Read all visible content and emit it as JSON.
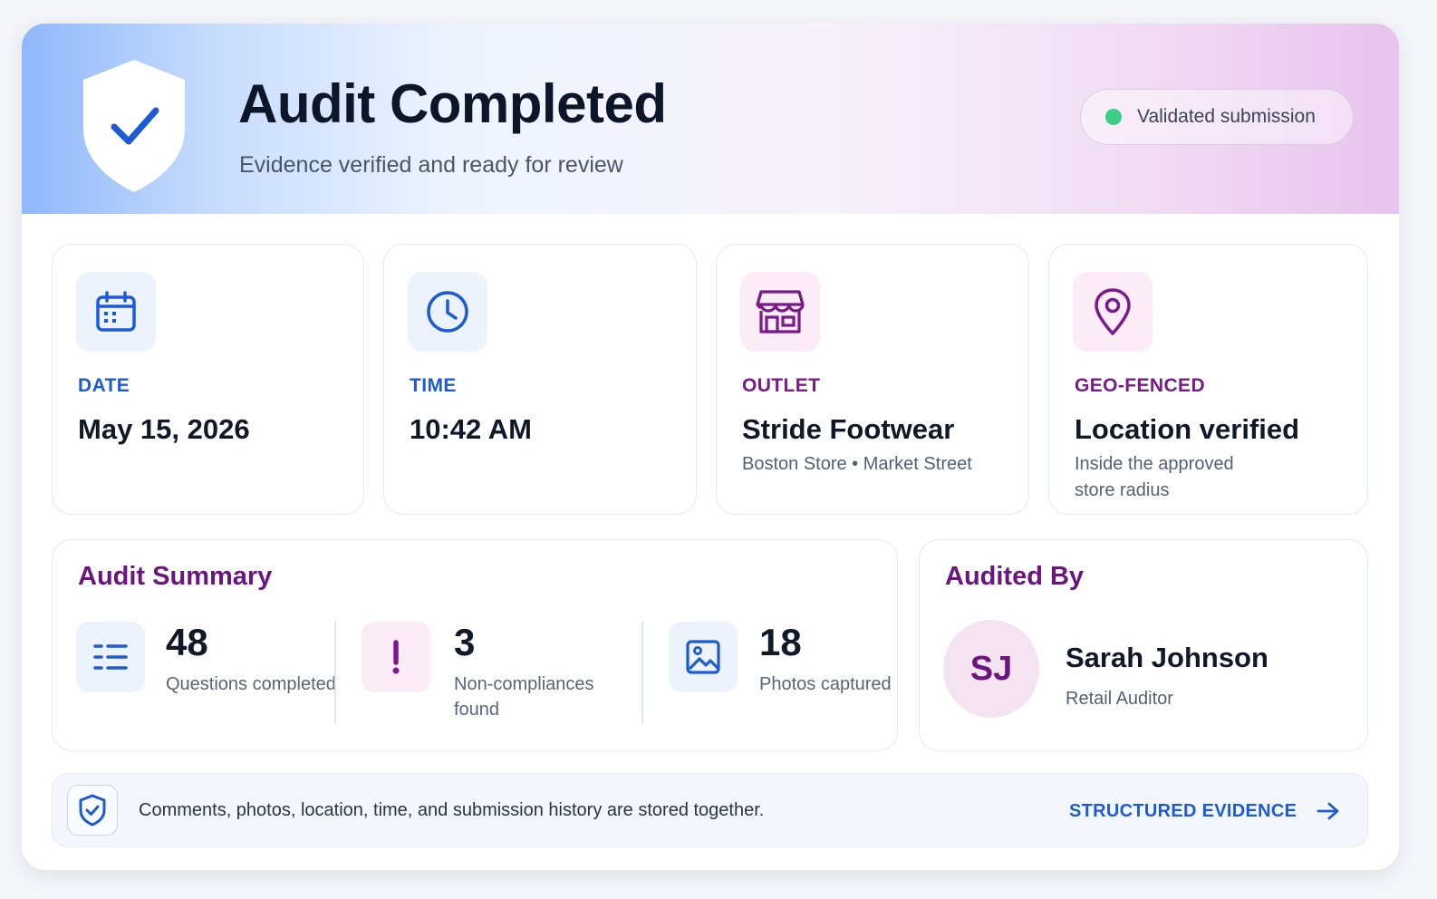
{
  "header": {
    "title": "Audit Completed",
    "subtitle": "Evidence verified and ready for review",
    "status_pill": "Validated submission",
    "status_color": "#3ccf88"
  },
  "info_cards": [
    {
      "icon": "calendar-icon",
      "label": "DATE",
      "value": "May 15, 2026",
      "sub": ""
    },
    {
      "icon": "clock-icon",
      "label": "TIME",
      "value": "10:42 AM",
      "sub": ""
    },
    {
      "icon": "storefront-icon",
      "label": "OUTLET",
      "value": "Stride Footwear",
      "sub": "Boston Store • Market Street"
    },
    {
      "icon": "map-pin-icon",
      "label": "GEO-FENCED",
      "value": "Location verified",
      "sub": "Inside the approved store radius"
    }
  ],
  "summary": {
    "title": "Audit Summary",
    "stats": [
      {
        "icon": "checklist-icon",
        "value": "48",
        "label": "Questions completed"
      },
      {
        "icon": "alert-icon",
        "value": "3",
        "label": "Non-compliances found"
      },
      {
        "icon": "image-icon",
        "value": "18",
        "label": "Photos captured"
      }
    ]
  },
  "auditor": {
    "title": "Audited By",
    "initials": "SJ",
    "name": "Sarah Johnson",
    "role": "Retail Auditor"
  },
  "footer": {
    "text": "Comments, photos, location, time, and submission history are stored together.",
    "link_label": "STRUCTURED EVIDENCE"
  },
  "colors": {
    "accent_blue": "#1d5bd6",
    "accent_purple": "#6c1480",
    "status_green": "#3ccf88"
  }
}
